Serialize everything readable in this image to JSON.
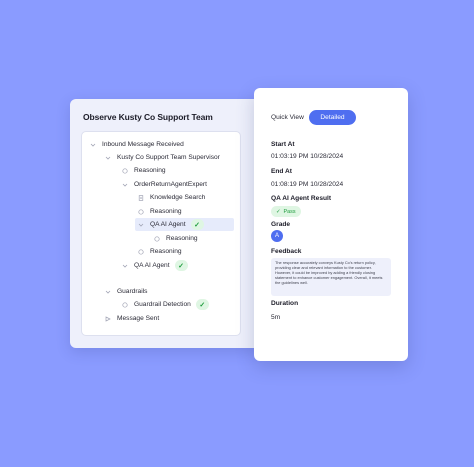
{
  "left": {
    "title": "Observe Kusty Co Support Team",
    "tree": [
      {
        "label": "Inbound Message Received",
        "icon": "chevron-down-icon"
      },
      {
        "label": "Kusty Co Support Team Supervisor",
        "icon": "chevron-down-icon"
      },
      {
        "label": "Reasoning",
        "icon": "reasoning-icon"
      },
      {
        "label": "OrderReturnAgentExpert",
        "icon": "chevron-down-icon"
      },
      {
        "label": "Knowledge Search",
        "icon": "document-icon"
      },
      {
        "label": "Reasoning",
        "icon": "reasoning-icon"
      },
      {
        "label": "QA AI Agent",
        "icon": "chevron-down-icon",
        "status": "✓"
      },
      {
        "label": "Reasoning",
        "icon": "reasoning-icon"
      },
      {
        "label": "Reasoning",
        "icon": "reasoning-icon"
      },
      {
        "label": "QA AI Agent",
        "icon": "chevron-down-icon",
        "status": "✓"
      },
      {
        "label": "Guardrails",
        "icon": "chevron-down-icon"
      },
      {
        "label": "Guardrail Detection",
        "icon": "shield-icon",
        "status": "✓"
      },
      {
        "label": "Message Sent",
        "icon": "send-icon"
      }
    ]
  },
  "right": {
    "quick_view": "Quick View",
    "detailed": "Detailed",
    "start_label": "Start At",
    "start_value": "01:03:19 PM 10/28/2024",
    "end_label": "End At",
    "end_value": "01:08:19 PM 10/28/2024",
    "result_label": "QA AI Agent Result",
    "result_value": "Pass",
    "grade_label": "Grade",
    "grade_value": "A",
    "feedback_label": "Feedback",
    "feedback_text": "The response accurately conveys Kusty Co's return policy, providing clear and relevant information to the customer. However, it could be improved by adding a friendly closing statement to enhance customer engagement. Overall, it meets the guidelines well.",
    "duration_label": "Duration",
    "duration_value": "5m"
  },
  "colors": {
    "background": "#8a9bff",
    "accent": "#4f6ef0",
    "pass_green": "#1e9c3d"
  }
}
